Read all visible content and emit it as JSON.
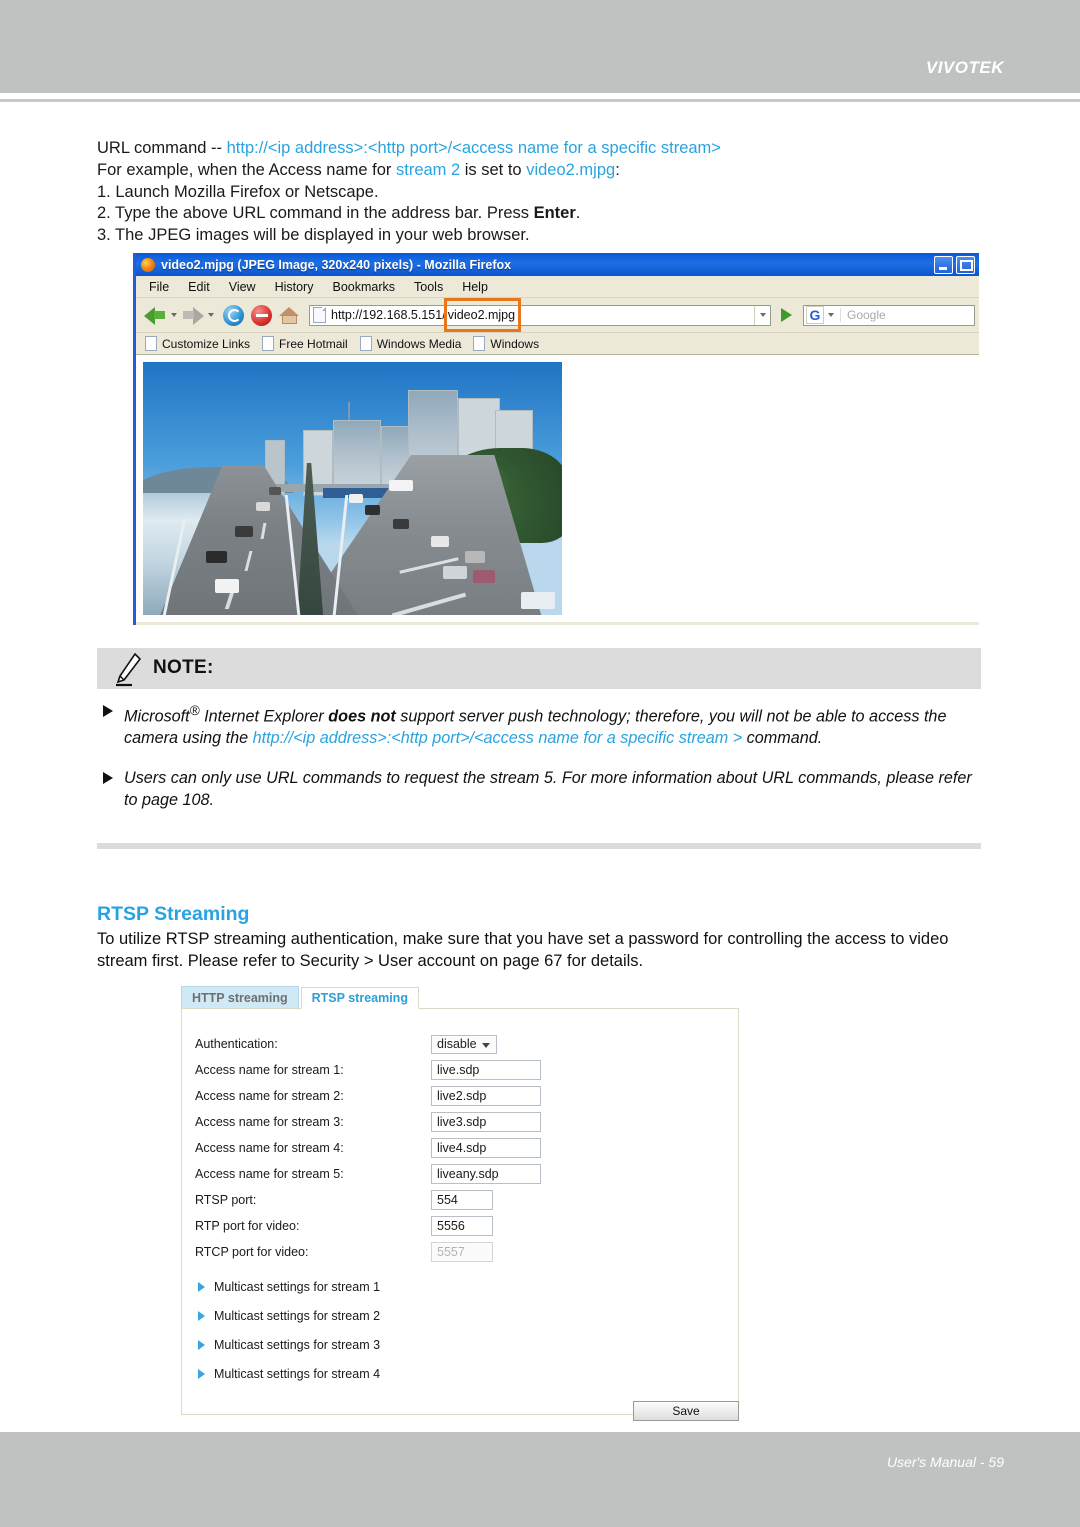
{
  "header": {
    "brand": "VIVOTEK"
  },
  "intro": {
    "line1_prefix": "URL command -- ",
    "line1_blue": "http://<ip address>:<http port>/<access name for a specific stream>",
    "line2_prefix": "For example, when the Access name for ",
    "line2_blue1": "stream 2",
    "line2_mid": " is set to ",
    "line2_blue2": "video2.mjpg",
    "line2_suffix": ":",
    "step1": "1. Launch Mozilla Firefox or Netscape.",
    "step2_a": "2. Type the above URL command in the address bar. Press ",
    "step2_bold": "Enter",
    "step2_b": ".",
    "step3": "3. The JPEG images will be displayed in your web browser."
  },
  "browser": {
    "title": "video2.mjpg (JPEG Image, 320x240 pixels) - Mozilla Firefox",
    "window_icon": "firefox-icon",
    "minimize_label": "",
    "maximize_label": "",
    "menu": [
      "File",
      "Edit",
      "View",
      "History",
      "Bookmarks",
      "Tools",
      "Help"
    ],
    "toolbar": {
      "back_icon": "back-arrow-icon",
      "forward_icon": "forward-arrow-icon",
      "reload_icon": "reload-icon",
      "stop_icon": "stop-icon",
      "home_icon": "home-icon",
      "url_base": "http://192.168.5.151/",
      "url_highlighted": "video2.mjpg",
      "go_icon": "go-arrow-icon",
      "search_engine": "G",
      "search_placeholder": "Google"
    },
    "bookmarks": [
      "Customize Links",
      "Free Hotmail",
      "Windows Media",
      "Windows"
    ],
    "content_image": "traffic-highway-camera-snapshot"
  },
  "note": {
    "title": "NOTE:",
    "icon": "pencil-icon",
    "items": [
      {
        "a": "Microsoft",
        "sup": "®",
        "b": " Internet Explorer ",
        "bold": "does not",
        "c": " support server push technology; therefore, you will not be able to access the camera using the ",
        "blue": "http://<ip address>:<http port>/<access name for a specific stream >",
        "d": " command."
      },
      {
        "text": "Users can only use URL commands to request the stream 5. For more information about URL commands, please refer to page 108."
      }
    ]
  },
  "rtsp_section": {
    "title": "RTSP Streaming",
    "body": "To utilize RTSP streaming authentication, make sure that you have set a password for controlling the access to video stream first. Please refer to Security > User account on page 67 for details."
  },
  "panel": {
    "tabs": [
      {
        "label": "HTTP streaming",
        "active": false
      },
      {
        "label": "RTSP streaming",
        "active": true
      }
    ],
    "rows": [
      {
        "label": "Authentication:",
        "value": "disable",
        "type": "select"
      },
      {
        "label": "Access name for stream 1:",
        "value": "live.sdp",
        "type": "text-wide"
      },
      {
        "label": "Access name for stream 2:",
        "value": "live2.sdp",
        "type": "text-wide"
      },
      {
        "label": "Access name for stream 3:",
        "value": "live3.sdp",
        "type": "text-wide"
      },
      {
        "label": "Access name for stream 4:",
        "value": "live4.sdp",
        "type": "text-wide"
      },
      {
        "label": "Access name for stream 5:",
        "value": "liveany.sdp",
        "type": "text-wide"
      },
      {
        "label": "RTSP port:",
        "value": "554",
        "type": "text-narrow"
      },
      {
        "label": "RTP port for video:",
        "value": "5556",
        "type": "text-narrow"
      },
      {
        "label": "RTCP port for video:",
        "value": "5557",
        "type": "text-narrow-disabled"
      }
    ],
    "multicast_links": [
      "Multicast settings for stream 1",
      "Multicast settings for stream 2",
      "Multicast settings for stream 3",
      "Multicast settings for stream 4"
    ],
    "save_label": "Save"
  },
  "footer": {
    "text": "User's Manual - 59"
  },
  "colors": {
    "accent_blue": "#29a3e0",
    "band_grey": "#c0c2c1",
    "note_grey": "#dcdcdc",
    "highlight_orange": "#e8761a",
    "tab_active_text": "#2a9fd8",
    "tab_inactive_bg": "#cfe9f7"
  }
}
